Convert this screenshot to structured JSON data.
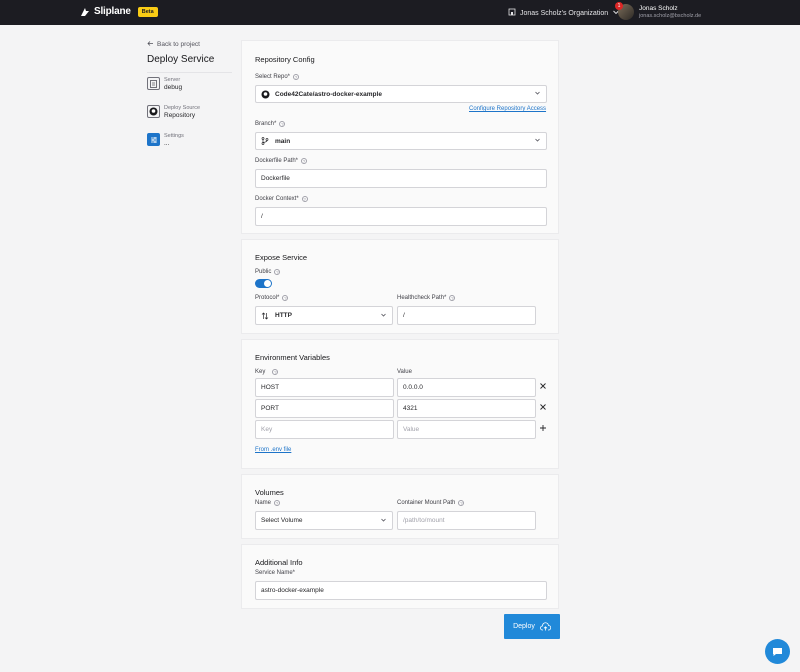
{
  "header": {
    "logo_text": "Sliplane",
    "beta_badge": "Beta",
    "org_name": "Jonas Scholz's Organization",
    "user_name": "Jonas Scholz",
    "user_email": "jonas.scholz@bscholz.de",
    "notification_count": "1",
    "progress_fraction": 0.5
  },
  "sidebar": {
    "back_label": "Back to project",
    "title": "Deploy Service",
    "steps": [
      {
        "label": "Server",
        "value": "debug"
      },
      {
        "label": "Deploy Source",
        "value": "Repository"
      },
      {
        "label": "Settings",
        "value": "..."
      }
    ]
  },
  "repository_config": {
    "title": "Repository Config",
    "repo_label": "Select Repo*",
    "repo_value": "Code42Cate/astro-docker-example",
    "configure_link": "Configure Repository Access",
    "branch_label": "Branch*",
    "branch_value": "main",
    "dockerfile_label": "Dockerfile Path*",
    "dockerfile_value": "Dockerfile",
    "context_label": "Docker Context*",
    "context_value": "/"
  },
  "expose_service": {
    "title": "Expose Service",
    "public_label": "Public",
    "public_enabled": true,
    "protocol_label": "Protocol*",
    "protocol_value": "HTTP",
    "healthcheck_label": "Healthcheck Path*",
    "healthcheck_value": "/"
  },
  "env_vars": {
    "title": "Environment Variables",
    "key_header": "Key",
    "value_header": "Value",
    "rows": [
      {
        "key": "HOST",
        "value": "0.0.0.0"
      },
      {
        "key": "PORT",
        "value": "4321"
      }
    ],
    "key_placeholder": "Key",
    "value_placeholder": "Value",
    "from_env_link": "From .env file"
  },
  "volumes": {
    "title": "Volumes",
    "name_label": "Name",
    "name_value": "Select Volume",
    "mount_label": "Container Mount Path",
    "mount_placeholder": "/path/to/mount"
  },
  "additional_info": {
    "title": "Additional Info",
    "service_name_label": "Service Name*",
    "service_name_value": "astro-docker-example"
  },
  "deploy_button": "Deploy",
  "colors": {
    "accent": "#2189d9",
    "topbar": "#1c1c22",
    "beta": "#facc15"
  }
}
